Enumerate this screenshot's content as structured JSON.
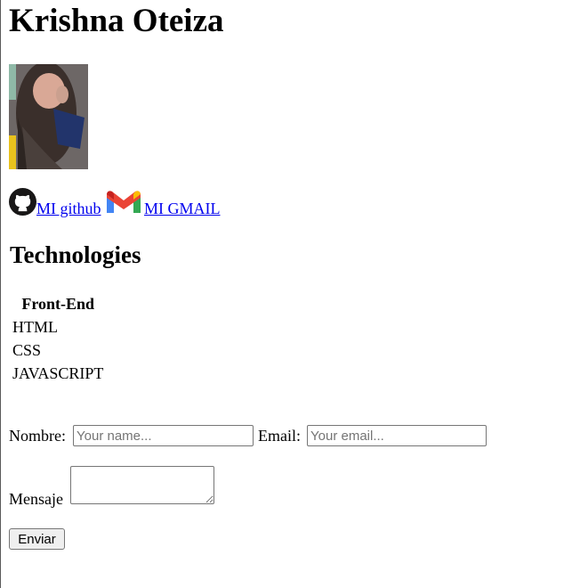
{
  "profile": {
    "name": "Krishna Oteiza"
  },
  "links": {
    "github_label": "MI github",
    "gmail_label": "MI GMAIL"
  },
  "technologies": {
    "heading": "Technologies",
    "column_header": "Front-End",
    "items": [
      "HTML",
      "CSS",
      "JAVASCRIPT"
    ]
  },
  "form": {
    "name_label": "Nombre:",
    "name_placeholder": "Your name...",
    "email_label": "Email:",
    "email_placeholder": "Your email...",
    "message_label": "Mensaje",
    "submit_label": "Enviar"
  },
  "colors": {
    "link": "#0000ee"
  }
}
